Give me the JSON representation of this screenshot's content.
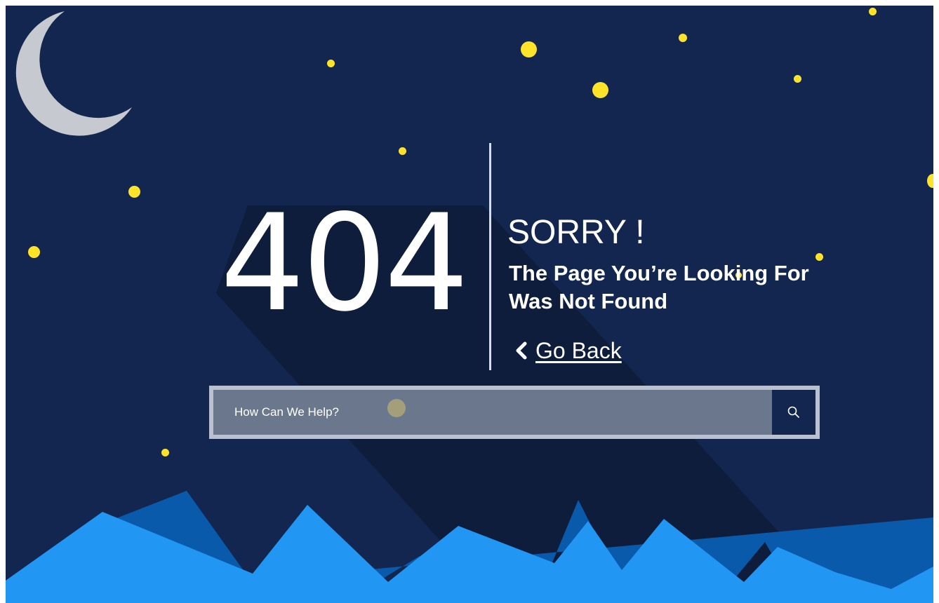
{
  "error": {
    "code": "404",
    "title": "SORRY !",
    "message_line1": "The Page You’re Looking For",
    "message_line2": "Was Not Found",
    "back_label": "Go Back"
  },
  "search": {
    "placeholder": "How Can We Help?",
    "button_icon": "search-icon"
  },
  "decor": {
    "moon_icon": "crescent-moon-icon",
    "back_icon": "chevron-left-icon"
  },
  "colors": {
    "sky": "#13264f",
    "shadow": "#0d1d3b",
    "star": "#ffe32a",
    "moon": "#c6c9cf",
    "mountain_front": "#2196f3",
    "mountain_back": "#0a5aab",
    "search_field": "#6b778c",
    "search_border": "#b9c0cf",
    "text": "#ffffff"
  }
}
